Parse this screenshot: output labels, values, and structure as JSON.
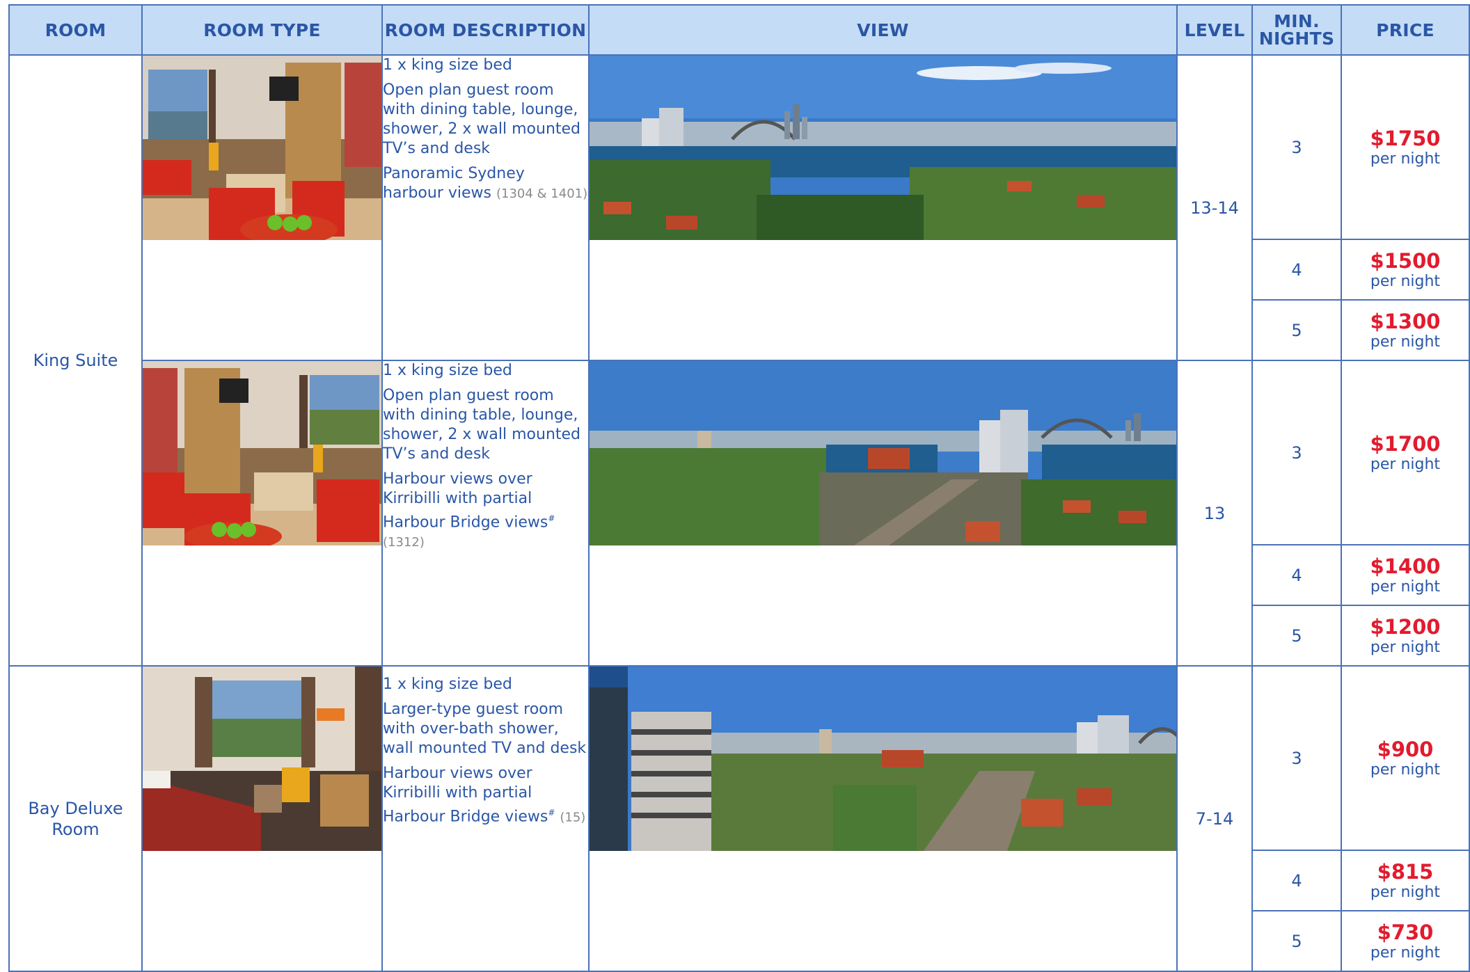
{
  "headers": {
    "room": "ROOM",
    "room_type": "ROOM TYPE",
    "room_description": "ROOM DESCRIPTION",
    "view": "VIEW",
    "level": "LEVEL",
    "min_nights_line1": "MIN.",
    "min_nights_line2": "NIGHTS",
    "price": "PRICE"
  },
  "rooms": [
    {
      "name": "King Suite",
      "variants": [
        {
          "bed": "1 x king size bed",
          "features": "Open plan guest room with dining table, lounge, shower, 2 x wall mounted TV’s and desk",
          "view_text": "Panoramic Sydney harbour views",
          "view_note": "(1304 & 1401)",
          "level": "13-14",
          "rates": [
            {
              "nights": "3",
              "price": "$1750",
              "unit": "per night"
            },
            {
              "nights": "4",
              "price": "$1500",
              "unit": "per night"
            },
            {
              "nights": "5",
              "price": "$1300",
              "unit": "per night"
            }
          ]
        },
        {
          "bed": "1 x king size bed",
          "features": "Open plan guest room with dining table, lounge, shower, 2 x wall mounted TV’s and desk",
          "view_text": "Harbour views over Kirribilli with partial Harbour Bridge views",
          "view_mark": "#",
          "view_note": "(1312)",
          "level": "13",
          "rates": [
            {
              "nights": "3",
              "price": "$1700",
              "unit": "per night"
            },
            {
              "nights": "4",
              "price": "$1400",
              "unit": "per night"
            },
            {
              "nights": "5",
              "price": "$1200",
              "unit": "per night"
            }
          ]
        }
      ]
    },
    {
      "name": "Bay Deluxe Room",
      "variants": [
        {
          "bed": "1 x king size bed",
          "features": "Larger-type guest room with over-bath shower, wall mounted TV and desk",
          "view_text": "Harbour views over Kirribilli with partial Harbour Bridge views",
          "view_mark": "#",
          "view_note": "(15)",
          "level": "7-14",
          "rates": [
            {
              "nights": "3",
              "price": "$900",
              "unit": "per night"
            },
            {
              "nights": "4",
              "price": "$815",
              "unit": "per night"
            },
            {
              "nights": "5",
              "price": "$730",
              "unit": "per night"
            }
          ]
        }
      ]
    }
  ]
}
